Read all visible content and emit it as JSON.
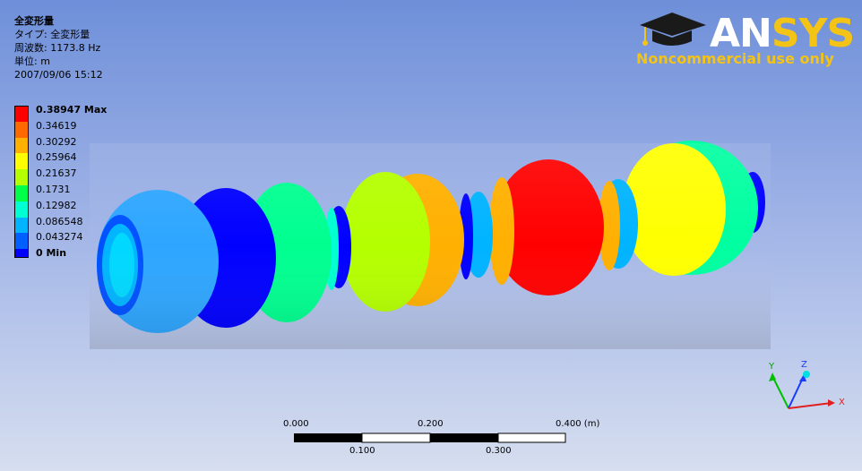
{
  "info": {
    "title": "全変形量",
    "type_line": "タイプ: 全変形量",
    "freq_line": "周波数: 1173.8 Hz",
    "unit_line": "単位: m",
    "date_line": "2007/09/06 15:12"
  },
  "legend": [
    {
      "label": "0.38947 Max",
      "color": "#ff0000",
      "bold": true
    },
    {
      "label": "0.34619",
      "color": "#ff6a00",
      "bold": false
    },
    {
      "label": "0.30292",
      "color": "#ffb000",
      "bold": false
    },
    {
      "label": "0.25964",
      "color": "#ffff00",
      "bold": false
    },
    {
      "label": "0.21637",
      "color": "#b4ff00",
      "bold": false
    },
    {
      "label": "0.1731",
      "color": "#00ff48",
      "bold": false
    },
    {
      "label": "0.12982",
      "color": "#00ffd2",
      "bold": false
    },
    {
      "label": "0.086548",
      "color": "#00b4ff",
      "bold": false
    },
    {
      "label": "0.043274",
      "color": "#0060ff",
      "bold": false
    },
    {
      "label": "0 Min",
      "color": "#0000ff",
      "bold": true
    }
  ],
  "logo": {
    "brand_an": "AN",
    "brand_sys": "SYS",
    "subtitle": "Noncommercial use only"
  },
  "scale": {
    "top_labels": [
      "0.000",
      "0.200",
      "0.400 (m)"
    ],
    "bottom_labels": [
      "0.100",
      "0.300"
    ]
  },
  "triad": {
    "x": "X",
    "y": "Y",
    "z": "Z"
  }
}
